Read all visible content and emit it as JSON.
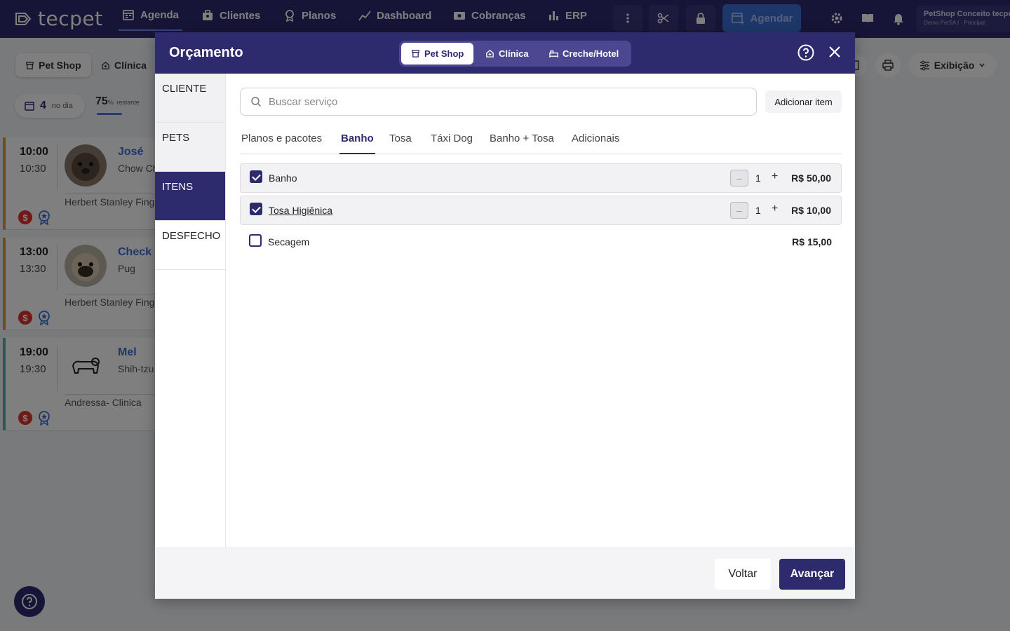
{
  "app": {
    "logo": "tecpet"
  },
  "nav": {
    "items": [
      {
        "label": "Agenda",
        "icon": "calendar-icon"
      },
      {
        "label": "Clientes",
        "icon": "clients-icon"
      },
      {
        "label": "Planos",
        "icon": "plans-icon"
      },
      {
        "label": "Dashboard",
        "icon": "chart-icon"
      },
      {
        "label": "Cobranças",
        "icon": "money-icon"
      },
      {
        "label": "ERP",
        "icon": "bars-icon"
      }
    ],
    "agendar": "Agendar",
    "account": {
      "name": "PetShop Conceito tecpet",
      "sub": "Demo PetSA I · Principal"
    }
  },
  "background": {
    "segments": [
      "Pet Shop",
      "Clínica"
    ],
    "day_count": "4",
    "day_label": "no dia",
    "percent": "75",
    "percent_unit": "%",
    "percent_label": "restante",
    "display_label": "Exibição",
    "appointments": [
      {
        "start": "10:00",
        "end": "10:30",
        "pet": "José",
        "breed": "Chow Chow",
        "owner": "Herbert Stanley Fingerman"
      },
      {
        "start": "13:00",
        "end": "13:30",
        "pet": "Check",
        "breed": "Pug",
        "owner": "Herbert Stanley Fingerman"
      },
      {
        "start": "19:00",
        "end": "19:30",
        "pet": "Mel",
        "breed": "Shih-tzu",
        "owner": "Andressa- Clinica"
      }
    ],
    "money_symbol": "$"
  },
  "modal": {
    "title": "Orçamento",
    "tabs": [
      "Pet Shop",
      "Clínica",
      "Creche/Hotel"
    ],
    "steps": [
      "CLIENTE",
      "PETS",
      "ITENS",
      "DESFECHO"
    ],
    "search_placeholder": "Buscar serviço",
    "add_item": "Adicionar item",
    "categories": [
      "Planos e pacotes",
      "Banho",
      "Tosa",
      "Táxi Dog",
      "Banho + Tosa",
      "Adicionais"
    ],
    "items": [
      {
        "name": "Banho",
        "checked": true,
        "qty": "1",
        "price": "R$ 50,00"
      },
      {
        "name": "Tosa Higiênica",
        "checked": true,
        "qty": "1",
        "price": "R$ 10,00"
      },
      {
        "name": "Secagem",
        "checked": false,
        "price": "R$ 15,00"
      }
    ],
    "minus": "–",
    "plus": "+",
    "back": "Voltar",
    "next": "Avançar"
  }
}
